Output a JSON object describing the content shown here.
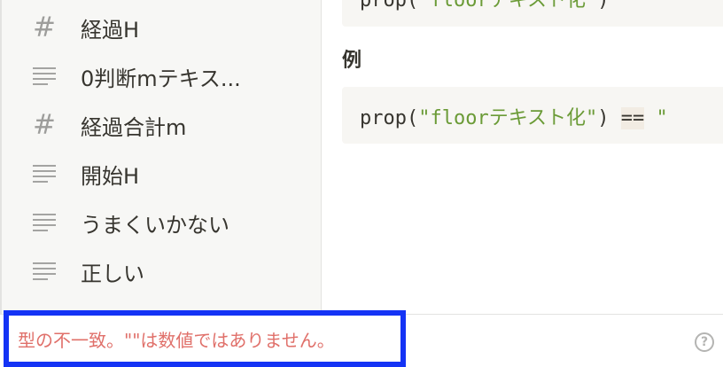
{
  "properties": [
    {
      "icon": "hash-icon",
      "label": "経過H"
    },
    {
      "icon": "text-lines-icon",
      "label": "0判断mテキス..."
    },
    {
      "icon": "hash-icon",
      "label": "経過合計m"
    },
    {
      "icon": "text-lines-icon",
      "label": "開始H"
    },
    {
      "icon": "text-lines-icon",
      "label": "うまくいかない"
    },
    {
      "icon": "text-lines-icon",
      "label": "正しい"
    }
  ],
  "detail": {
    "top_code": {
      "prefix": "prop(",
      "str": "\"floorテキスト化\"",
      "suffix": ")"
    },
    "example_title": "例",
    "example_code": {
      "prefix": "prop(",
      "str": "\"floorテキスト化\"",
      "close": ") ",
      "op": "==",
      "tail": " \""
    }
  },
  "footer": {
    "error_message": "型の不一致。\"\"は数値ではありません。",
    "help_symbol": "?"
  }
}
